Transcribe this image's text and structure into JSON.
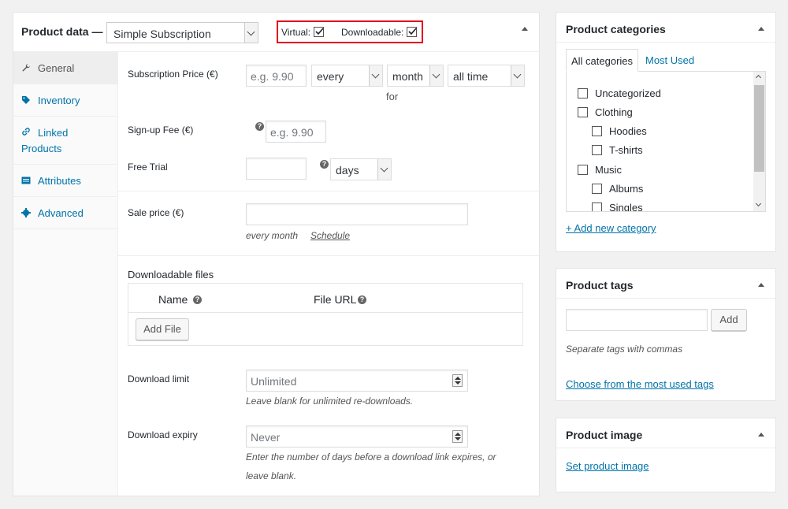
{
  "product_data": {
    "title": "Product data —",
    "product_type": "Simple Subscription",
    "virtual_label": "Virtual:",
    "virtual_checked": true,
    "downloadable_label": "Downloadable:",
    "downloadable_checked": true,
    "tabs": [
      {
        "label": "General",
        "icon": "wrench-icon"
      },
      {
        "label": "Inventory",
        "icon": "tag-icon"
      },
      {
        "label": "Linked Products",
        "icon": "link-icon"
      },
      {
        "label": "Attributes",
        "icon": "list-icon"
      },
      {
        "label": "Advanced",
        "icon": "gear-icon"
      }
    ],
    "general": {
      "subscription_price_label": "Subscription Price (€)",
      "subscription_price_placeholder": "e.g. 9.90",
      "interval": "every",
      "period": "month",
      "length": "all time",
      "for_label": "for",
      "signup_fee_label": "Sign-up Fee (€)",
      "signup_fee_placeholder": "e.g. 9.90",
      "free_trial_label": "Free Trial",
      "trial_period": "days",
      "sale_price_label": "Sale price (€)",
      "sale_period": "every month",
      "schedule_link": "Schedule",
      "downloadable_files_label": "Downloadable files",
      "col_name": "Name",
      "col_file_url": "File URL",
      "add_file": "Add File",
      "download_limit_label": "Download limit",
      "download_limit_placeholder": "Unlimited",
      "download_limit_desc": "Leave blank for unlimited re-downloads.",
      "download_expiry_label": "Download expiry",
      "download_expiry_placeholder": "Never",
      "download_expiry_desc_1": "Enter the number of days before a download link expires, or",
      "download_expiry_desc_2": "leave blank."
    }
  },
  "categories": {
    "title": "Product categories",
    "tab_all": "All categories",
    "tab_most_used": "Most Used",
    "items": [
      {
        "label": "Uncategorized",
        "level": 0
      },
      {
        "label": "Clothing",
        "level": 0
      },
      {
        "label": "Hoodies",
        "level": 1
      },
      {
        "label": "T-shirts",
        "level": 1
      },
      {
        "label": "Music",
        "level": 0
      },
      {
        "label": "Albums",
        "level": 1
      },
      {
        "label": "Singles",
        "level": 1
      }
    ],
    "add_new": "+ Add new category"
  },
  "tags": {
    "title": "Product tags",
    "add_button": "Add",
    "hint": "Separate tags with commas",
    "choose_link": "Choose from the most used tags"
  },
  "image": {
    "title": "Product image",
    "set_link": "Set product image"
  },
  "colors": {
    "link": "#0073aa",
    "highlight_border": "#e2001a",
    "background": "#f1f1f1"
  }
}
